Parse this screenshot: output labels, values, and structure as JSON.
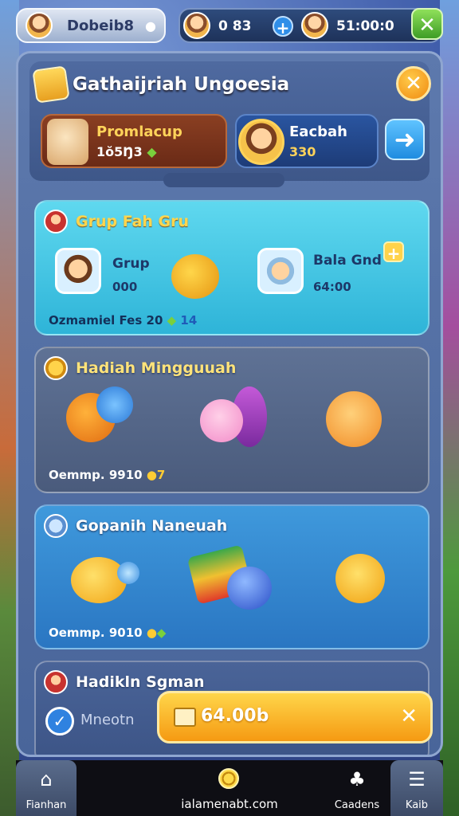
{
  "topbar": {
    "player_name": "Dobeib8",
    "resource_1": "0 83",
    "resource_2": "51:00:0"
  },
  "header": {
    "title": "Gathaijriah Ungoesia",
    "promo": {
      "title": "Promlacup",
      "value": "1ŏ5Ŋ3"
    },
    "friend": {
      "title": "Eacbah",
      "value": "330"
    }
  },
  "group_card": {
    "title": "Grup Fah Gru",
    "member_1": {
      "label": "Grup",
      "value": "000"
    },
    "member_2": {
      "label": "Bala Gnd",
      "value": "64:00"
    },
    "footer": "Ozmamiel Fes 20",
    "footer_count": "14"
  },
  "weekly_card": {
    "title": "Hadiah Mingguuah",
    "footer": "Oemmp. 9910",
    "footer_count": "7"
  },
  "third_card": {
    "title": "Gopanih Naneuah",
    "footer": "Oemmp. 9010"
  },
  "fourth_card": {
    "title": "Hadikln Sgman",
    "meeting_label": "Mneotn",
    "claim_label": "64.00b"
  },
  "nav": {
    "home": "Fianhan",
    "domain": "ialamenabt.com",
    "gardens": "Caadens",
    "settings": "Kaib"
  },
  "colors": {
    "accent_orange": "#f59a12",
    "cyan_card": "#2eb4d8",
    "blue_card": "#2a76c2",
    "green_close": "#3e9d26"
  },
  "icons": [
    "user-avatar",
    "camera-icon",
    "plus-icon",
    "close-icon",
    "arrow-right-icon",
    "check-icon",
    "home-icon",
    "coin-icon",
    "gardens-icon",
    "menu-icon"
  ]
}
